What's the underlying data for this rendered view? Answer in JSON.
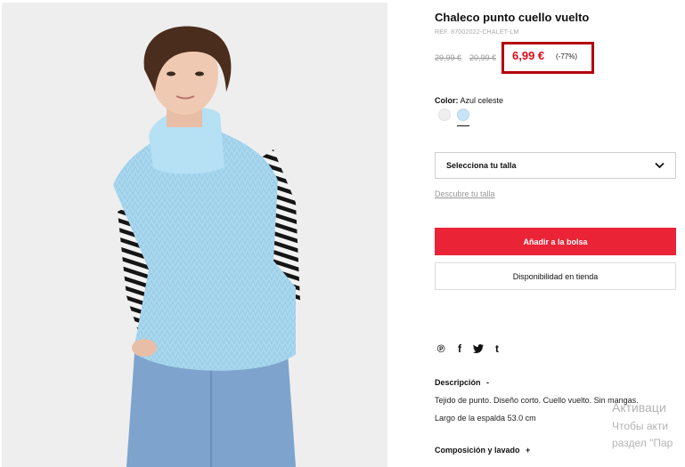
{
  "product": {
    "title": "Chaleco punto cuello vuelto",
    "ref": "REF. 87002022-CHALET-LM",
    "original_price_1": "29,99 €",
    "original_price_2": "20,99 €",
    "sale_price": "6,99 €",
    "discount": "(-77%)",
    "color_label": "Color:",
    "color_value": "Azul celeste"
  },
  "colors": {
    "sale": "#e00b17",
    "highlight_box": "#b3000c",
    "add_button": "#ea2336",
    "swatch_white": "#efefef",
    "swatch_blue": "#c9e4f8"
  },
  "size": {
    "select_label": "Selecciona tu talla",
    "guide_link": "Descubre tu talla"
  },
  "actions": {
    "add_to_bag": "Añadir a la bolsa",
    "store_availability": "Disponibilidad en tienda"
  },
  "share_icons": [
    "pinterest-icon",
    "facebook-icon",
    "twitter-icon",
    "tumblr-icon"
  ],
  "description": {
    "title": "Descripción",
    "toggle": "-",
    "line1": "Tejido de punto. Diseño corto. Cuello vuelto. Sin mangas.",
    "line2": "Largo de la espalda 53.0 cm"
  },
  "composition": {
    "title": "Composición y lavado",
    "toggle": "+"
  },
  "watermark": {
    "line1": "Активаци",
    "line2": "Чтобы акти",
    "line3": "раздел \"Пар"
  }
}
